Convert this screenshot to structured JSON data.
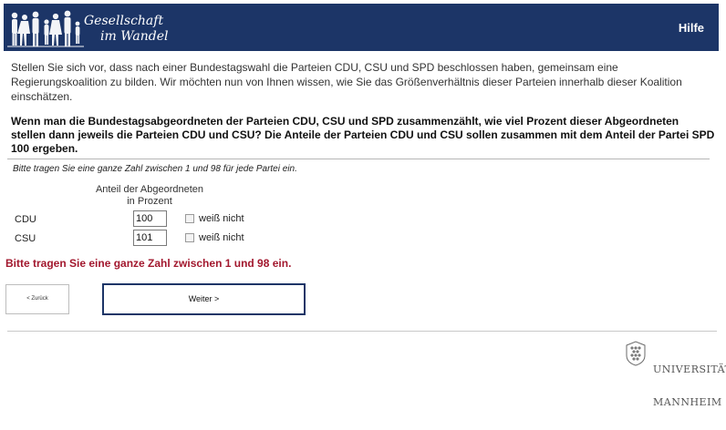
{
  "header": {
    "logo_line1": "Gesellschaft",
    "logo_line2": "im Wandel",
    "help_label": "Hilfe",
    "bg_color": "#1c3567"
  },
  "intro_text": "Stellen Sie sich vor, dass nach einer Bundestagswahl die Parteien CDU, CSU und SPD beschlossen haben, gemeinsam eine Regierungskoalition zu bilden. Wir möchten nun von Ihnen wissen, wie Sie das Größenverhältnis dieser Parteien innerhalb dieser Koalition einschätzen.",
  "question_text": "Wenn man die Bundestagsabgeordneten der Parteien CDU, CSU und SPD zusammenzählt, wie viel Prozent dieser Abgeordneten stellen dann jeweils die Parteien CDU und CSU? Die Anteile der Parteien CDU und CSU sollen zusammen mit dem Anteil der Partei SPD 100 ergeben.",
  "instruction_text": "Bitte tragen Sie eine ganze Zahl zwischen 1 und 98 für jede Partei ein.",
  "table": {
    "column_header_line1": "Anteil der Abgeordneten",
    "column_header_line2": "in Prozent",
    "rows": [
      {
        "label": "CDU",
        "value": "100",
        "dont_know_label": "weiß nicht",
        "dont_know_checked": false
      },
      {
        "label": "CSU",
        "value": "101",
        "dont_know_label": "weiß nicht",
        "dont_know_checked": false
      }
    ]
  },
  "error_message": "Bitte tragen Sie eine ganze Zahl zwischen 1 und 98 ein.",
  "error_color": "#a2182e",
  "buttons": {
    "back_label": "< Zurück",
    "next_label": "Weiter >"
  },
  "footer": {
    "university_line1": "UNIVERSITÄT",
    "university_line2": "MANNHEIM",
    "crest_icon": "university-crest-icon"
  }
}
